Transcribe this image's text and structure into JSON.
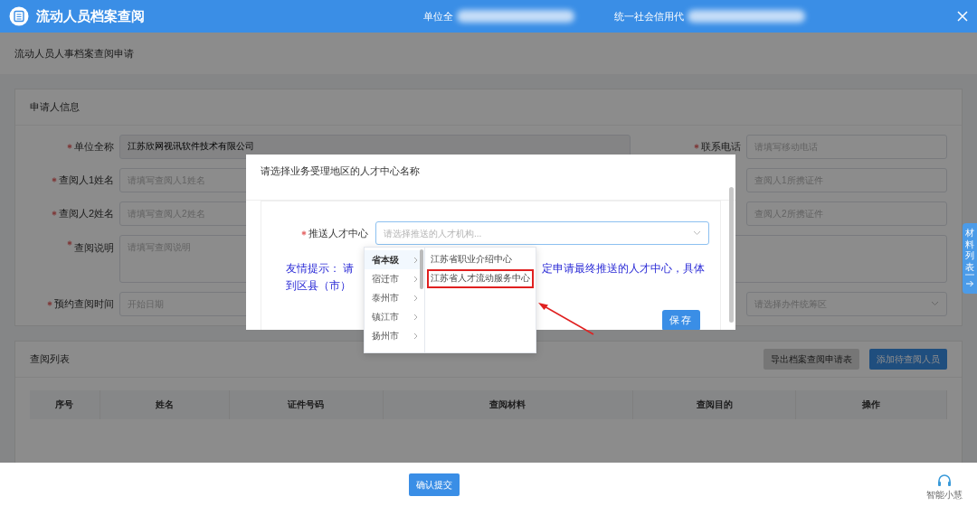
{
  "header": {
    "title": "流动人员档案查阅",
    "fields": [
      {
        "label": "单位全"
      },
      {
        "label": "统一社会信用代"
      }
    ]
  },
  "page_title": "流动人员人事档案查阅申请",
  "applicant": {
    "title": "申请人信息",
    "rows": [
      {
        "left": {
          "label": "单位全称",
          "required": true,
          "kind": "input",
          "value": "江苏欣网视讯软件技术有限公司",
          "disabled": true
        },
        "right": {
          "label": "联系电话",
          "required": true,
          "kind": "input",
          "placeholder": "请填写移动电话"
        }
      },
      {
        "left": {
          "label": "查阅人1姓名",
          "required": true,
          "kind": "input",
          "placeholder": "请填写查阅人1姓名"
        },
        "right": {
          "kind": "input",
          "placeholder": "查阅人1所携证件"
        }
      },
      {
        "left": {
          "label": "查阅人2姓名",
          "required": true,
          "kind": "input",
          "placeholder": "请填写查阅人2姓名"
        },
        "right": {
          "kind": "input",
          "placeholder": "查阅人2所携证件"
        }
      },
      {
        "full": {
          "label": "查阅说明",
          "required": true,
          "kind": "textarea",
          "placeholder": "请填写查阅说明"
        }
      },
      {
        "left": {
          "label": "预约查阅时间",
          "required": true,
          "kind": "input",
          "placeholder": "开始日期"
        },
        "right": {
          "kind": "select",
          "placeholder": "请选择办件统筹区"
        }
      }
    ]
  },
  "list": {
    "title": "查阅列表",
    "buttons": [
      {
        "label": "导出档案查阅申请表",
        "kind": "secondary"
      },
      {
        "label": "添加待查阅人员",
        "kind": "primary"
      }
    ],
    "columns": [
      "序号",
      "姓名",
      "证件号码",
      "查阅材料",
      "查阅目的",
      "操作"
    ]
  },
  "side_tab": {
    "label": "材料列表"
  },
  "footer": {
    "submit": "确认提交",
    "assistant": "智能小慧"
  },
  "modal": {
    "title": "请选择业务受理地区的人才中心名称",
    "field": {
      "label": "推送人才中心",
      "required": true,
      "placeholder": "请选择推送的人才机构..."
    },
    "hint": [
      "友情提示： 请",
      "定申请最终推送的人才中心，具体",
      "到区县（市）"
    ],
    "save": "保存"
  },
  "cascader": {
    "regions": [
      {
        "label": "省本级",
        "selected": true
      },
      {
        "label": "宿迁市",
        "selected": false
      },
      {
        "label": "泰州市",
        "selected": false
      },
      {
        "label": "镇江市",
        "selected": false
      },
      {
        "label": "扬州市",
        "selected": false
      }
    ],
    "options": [
      {
        "label": "江苏省职业介绍中心",
        "marked": false
      },
      {
        "label": "江苏省人才流动服务中心",
        "marked": true
      }
    ]
  }
}
